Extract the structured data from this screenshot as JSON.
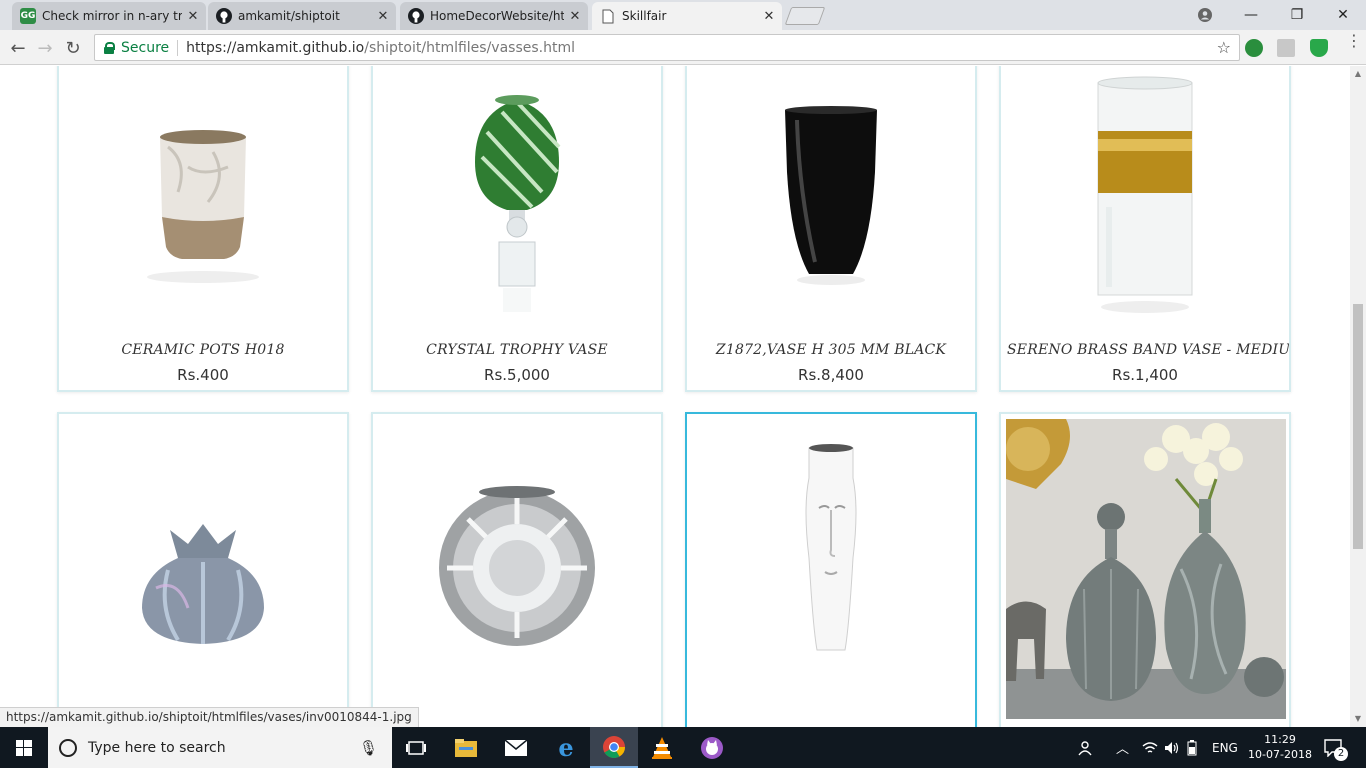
{
  "browser": {
    "tabs": [
      {
        "label": "Check mirror in n-ary tree",
        "favicon": "geeksforgeeks-icon",
        "color": "#2f8d46"
      },
      {
        "label": "amkamit/shiptoit",
        "favicon": "github-icon",
        "color": "#222222"
      },
      {
        "label": "HomeDecorWebsite/htm",
        "favicon": "github-icon",
        "color": "#222222"
      },
      {
        "label": "Skillfair",
        "favicon": "page-icon",
        "color": "#ffffff"
      }
    ],
    "secure_label": "Secure",
    "url_host": "https://amkamit.github.io",
    "url_path": "/shiptoit/htmlfiles/vasses.html"
  },
  "products": [
    {
      "name": "CERAMIC POTS H018",
      "price": "Rs.400"
    },
    {
      "name": "CRYSTAL TROPHY VASE",
      "price": "Rs.5,000"
    },
    {
      "name": "Z1872,VASE H 305 MM BLACK",
      "price": "Rs.8,400"
    },
    {
      "name": "SERENO BRASS BAND VASE - MEDIU",
      "price": "Rs.1,400"
    },
    {
      "name": "",
      "price": ""
    },
    {
      "name": "",
      "price": ""
    },
    {
      "name": "",
      "price": ""
    },
    {
      "name": "",
      "price": ""
    }
  ],
  "status_url": "https://amkamit.github.io/shiptoit/htmlfiles/vases/inv0010844-1.jpg",
  "taskbar": {
    "search_placeholder": "Type here to search",
    "language": "ENG",
    "time": "11:29",
    "date": "10-07-2018",
    "notification_count": "2"
  },
  "colors": {
    "card_border": "#d5ecef",
    "card_border_active": "#37b9dc",
    "taskbar_bg": "#101820"
  }
}
